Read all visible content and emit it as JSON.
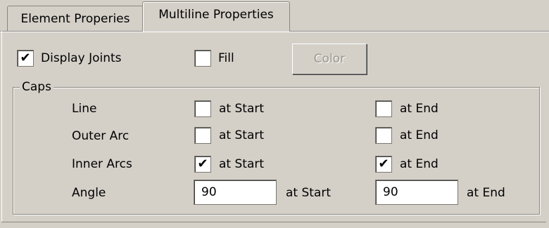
{
  "tabs": [
    {
      "label": "Element Properies",
      "active": false
    },
    {
      "label": "Multiline Properties",
      "active": true
    }
  ],
  "display_joints": {
    "label": "Display Joints",
    "checked": true
  },
  "fill": {
    "label": "Fill",
    "checked": false
  },
  "color_button": {
    "label": "Color",
    "enabled": false
  },
  "caps": {
    "title": "Caps",
    "rows": [
      {
        "label": "Line",
        "start_label": "at Start",
        "start_checked": false,
        "end_label": "at End",
        "end_checked": false
      },
      {
        "label": "Outer Arc",
        "start_label": "at Start",
        "start_checked": false,
        "end_label": "at End",
        "end_checked": false
      },
      {
        "label": "Inner Arcs",
        "start_label": "at Start",
        "start_checked": true,
        "end_label": "at End",
        "end_checked": true
      }
    ],
    "angle": {
      "label": "Angle",
      "start_value": "90",
      "start_label": "at Start",
      "end_value": "90",
      "end_label": "at End"
    }
  },
  "check_glyph": "✔"
}
